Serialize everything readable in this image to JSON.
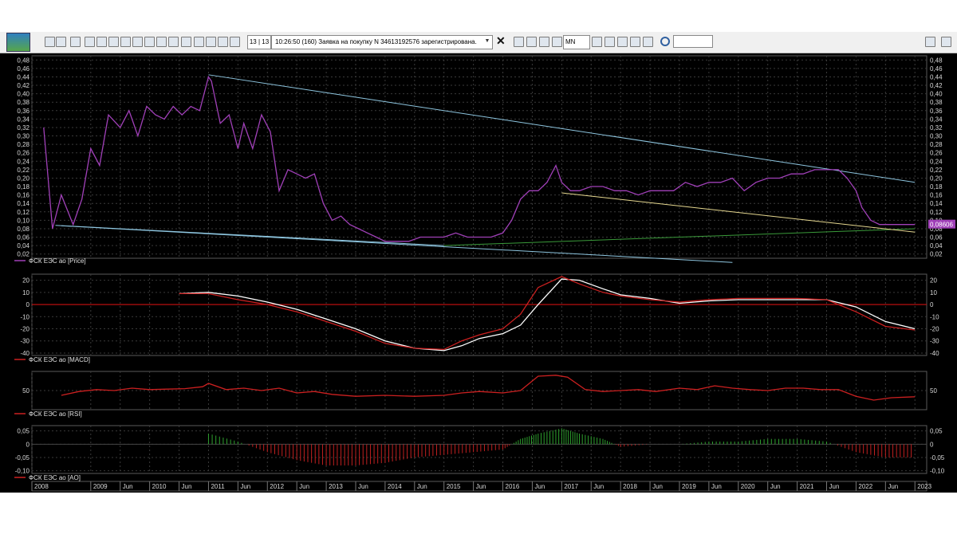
{
  "toolbar": {
    "counter": "13 | 13",
    "order_message": "10:26:50  (160)  Заявка на покупку N 34613192576 зарегистрирована.",
    "interval": "MN",
    "search_placeholder": ""
  },
  "chart_data": [
    {
      "type": "line",
      "legend": "ФСК ЕЭС ао [Price]",
      "ylim": [
        0.01,
        0.49
      ],
      "y_ticks": [
        "0,48",
        "0,46",
        "0,44",
        "0,42",
        "0,40",
        "0,38",
        "0,36",
        "0,34",
        "0,32",
        "0,30",
        "0,28",
        "0,26",
        "0,24",
        "0,22",
        "0,20",
        "0,18",
        "0,16",
        "0,14",
        "0,12",
        "0,10",
        "0,08",
        "0,06",
        "0,04",
        "0,02"
      ],
      "last_value_label": "0,08606",
      "colors": {
        "price": "#a040b8",
        "trend_upper": "#8ec6e0",
        "trend_lower": "#8ec6e0",
        "support": "#3a9a3a",
        "channel": "#e6d890"
      },
      "x": [
        2008.2,
        2008.35,
        2008.5,
        2008.7,
        2008.85,
        2009.0,
        2009.15,
        2009.3,
        2009.5,
        2009.65,
        2009.8,
        2009.95,
        2010.1,
        2010.25,
        2010.4,
        2010.55,
        2010.7,
        2010.85,
        2011.0,
        2011.05,
        2011.2,
        2011.35,
        2011.5,
        2011.6,
        2011.75,
        2011.9,
        2012.05,
        2012.2,
        2012.35,
        2012.5,
        2012.65,
        2012.8,
        2012.95,
        2013.1,
        2013.25,
        2013.4,
        2013.55,
        2013.7,
        2013.85,
        2014.0,
        2014.2,
        2014.4,
        2014.6,
        2014.8,
        2015.0,
        2015.2,
        2015.4,
        2015.6,
        2015.8,
        2016.0,
        2016.15,
        2016.3,
        2016.45,
        2016.6,
        2016.75,
        2016.9,
        2017.0,
        2017.15,
        2017.3,
        2017.5,
        2017.7,
        2017.9,
        2018.1,
        2018.3,
        2018.5,
        2018.7,
        2018.9,
        2019.1,
        2019.3,
        2019.5,
        2019.7,
        2019.9,
        2020.1,
        2020.3,
        2020.5,
        2020.7,
        2020.9,
        2021.1,
        2021.3,
        2021.5,
        2021.7,
        2021.85,
        2022.0,
        2022.1,
        2022.25,
        2022.4,
        2022.55,
        2022.7,
        2022.85,
        2023.0
      ],
      "y": [
        0.32,
        0.08,
        0.16,
        0.09,
        0.15,
        0.27,
        0.23,
        0.35,
        0.32,
        0.36,
        0.3,
        0.37,
        0.35,
        0.34,
        0.37,
        0.35,
        0.37,
        0.36,
        0.44,
        0.43,
        0.33,
        0.35,
        0.27,
        0.33,
        0.27,
        0.35,
        0.31,
        0.17,
        0.22,
        0.21,
        0.2,
        0.21,
        0.14,
        0.1,
        0.11,
        0.09,
        0.08,
        0.07,
        0.06,
        0.05,
        0.05,
        0.05,
        0.06,
        0.06,
        0.06,
        0.07,
        0.06,
        0.06,
        0.06,
        0.07,
        0.1,
        0.15,
        0.17,
        0.17,
        0.19,
        0.23,
        0.19,
        0.17,
        0.17,
        0.18,
        0.18,
        0.17,
        0.17,
        0.16,
        0.17,
        0.17,
        0.17,
        0.19,
        0.18,
        0.19,
        0.19,
        0.2,
        0.17,
        0.19,
        0.2,
        0.2,
        0.21,
        0.21,
        0.22,
        0.22,
        0.22,
        0.2,
        0.17,
        0.13,
        0.1,
        0.09,
        0.09,
        0.09,
        0.09,
        0.09
      ],
      "trendlines": [
        {
          "from": [
            2011.0,
            0.445
          ],
          "to": [
            2023.0,
            0.19
          ],
          "color": "#8ec6e0"
        },
        {
          "from": [
            2008.5,
            0.087
          ],
          "to": [
            2019.9,
            0.0
          ],
          "color": "#8ec6e0"
        },
        {
          "from": [
            2008.4,
            0.088
          ],
          "to": [
            2015.0,
            0.04
          ],
          "color": "#8ec6e0"
        },
        {
          "from": [
            2015.0,
            0.04
          ],
          "to": [
            2023.0,
            0.08
          ],
          "color": "#3a9a3a"
        },
        {
          "from": [
            2017.0,
            0.165
          ],
          "to": [
            2023.0,
            0.072
          ],
          "color": "#e6d890"
        }
      ]
    },
    {
      "type": "line",
      "legend": "ФСК ЕЭС ао [MACD]",
      "ylim": [
        -42,
        25
      ],
      "y_ticks": [
        "20",
        "10",
        "0",
        "-10",
        "-20",
        "-30",
        "-40"
      ],
      "zero_line_color": "#cc1111",
      "series": [
        {
          "color": "#ffffff",
          "x": [
            2010.5,
            2011.0,
            2011.5,
            2012.0,
            2012.5,
            2013.0,
            2013.5,
            2014.0,
            2014.5,
            2015.0,
            2015.3,
            2015.6,
            2016.0,
            2016.3,
            2016.6,
            2017.0,
            2017.3,
            2017.7,
            2018.0,
            2018.5,
            2019.0,
            2019.5,
            2020.0,
            2020.5,
            2021.0,
            2021.5,
            2022.0,
            2022.5,
            2023.0
          ],
          "y": [
            9,
            10,
            7,
            2,
            -4,
            -12,
            -20,
            -30,
            -36,
            -38,
            -34,
            -28,
            -24,
            -17,
            0,
            21,
            20,
            13,
            8,
            5,
            1,
            3,
            4,
            4,
            4,
            4,
            -2,
            -14,
            -20
          ]
        },
        {
          "color": "#cc2020",
          "x": [
            2010.5,
            2011.0,
            2011.5,
            2012.0,
            2012.5,
            2013.0,
            2013.5,
            2014.0,
            2014.5,
            2015.0,
            2015.3,
            2015.6,
            2016.0,
            2016.3,
            2016.6,
            2017.0,
            2017.3,
            2017.7,
            2018.0,
            2018.5,
            2019.0,
            2019.5,
            2020.0,
            2020.5,
            2021.0,
            2021.5,
            2022.0,
            2022.5,
            2023.0
          ],
          "y": [
            9,
            9,
            4,
            0,
            -6,
            -14,
            -22,
            -32,
            -36,
            -37,
            -30,
            -25,
            -20,
            -8,
            14,
            23,
            17,
            10,
            7,
            4,
            2,
            4,
            5,
            5,
            5,
            4,
            -6,
            -18,
            -21
          ]
        }
      ]
    },
    {
      "type": "line",
      "legend": "ФСК ЕЭС ао [RSI]",
      "ylim": [
        10,
        90
      ],
      "y_ticks": [
        "50"
      ],
      "series": [
        {
          "color": "#cc2020",
          "x": [
            2008.5,
            2008.8,
            2009.1,
            2009.4,
            2009.7,
            2010.0,
            2010.3,
            2010.6,
            2010.9,
            2011.0,
            2011.3,
            2011.6,
            2011.9,
            2012.2,
            2012.5,
            2012.8,
            2013.1,
            2013.5,
            2014.0,
            2014.5,
            2015.0,
            2015.3,
            2015.6,
            2016.0,
            2016.3,
            2016.6,
            2016.9,
            2017.1,
            2017.4,
            2017.7,
            2018.0,
            2018.3,
            2018.6,
            2019.0,
            2019.3,
            2019.6,
            2019.9,
            2020.2,
            2020.5,
            2020.8,
            2021.1,
            2021.4,
            2021.7,
            2022.0,
            2022.3,
            2022.6,
            2023.0
          ],
          "y": [
            40,
            48,
            52,
            50,
            55,
            52,
            53,
            54,
            58,
            65,
            52,
            55,
            50,
            55,
            45,
            48,
            42,
            38,
            40,
            38,
            40,
            45,
            48,
            45,
            50,
            80,
            82,
            78,
            52,
            48,
            50,
            52,
            48,
            55,
            52,
            60,
            55,
            52,
            50,
            55,
            55,
            52,
            52,
            38,
            30,
            35,
            37
          ]
        }
      ]
    },
    {
      "type": "bar",
      "legend": "ФСК ЕЭС ао [AO]",
      "ylim": [
        -0.11,
        0.07
      ],
      "y_ticks": [
        "0,05",
        "0",
        "-0,05",
        "-0,10"
      ],
      "colors": {
        "up": "#2ea02e",
        "down": "#c02020"
      },
      "x": [
        2011.0,
        2011.5,
        2012.0,
        2012.5,
        2013.0,
        2013.5,
        2014.0,
        2014.5,
        2015.0,
        2015.5,
        2016.0,
        2016.3,
        2016.6,
        2017.0,
        2017.3,
        2017.7,
        2018.0,
        2018.5,
        2019.0,
        2019.5,
        2020.0,
        2020.5,
        2021.0,
        2021.5,
        2022.0,
        2022.5,
        2023.0
      ],
      "values": [
        0.04,
        0.01,
        -0.03,
        -0.06,
        -0.08,
        -0.08,
        -0.07,
        -0.05,
        -0.04,
        -0.03,
        -0.02,
        0.02,
        0.04,
        0.06,
        0.04,
        0.02,
        -0.01,
        0.0,
        0.0,
        0.01,
        0.01,
        0.02,
        0.02,
        0.01,
        -0.03,
        -0.05,
        -0.05
      ]
    }
  ],
  "time_axis": {
    "labels": [
      "2008",
      "2009",
      "Jun",
      "2010",
      "Jun",
      "2011",
      "Jun",
      "2012",
      "Jun",
      "2013",
      "Jun",
      "2014",
      "Jun",
      "2015",
      "Jun",
      "2016",
      "Jun",
      "2017",
      "Jun",
      "2018",
      "Jun",
      "2019",
      "Jun",
      "2020",
      "Jun",
      "2021",
      "Jun",
      "2022",
      "Jun",
      "2023"
    ],
    "values": [
      2008,
      2009,
      2009.5,
      2010,
      2010.5,
      2011,
      2011.5,
      2012,
      2012.5,
      2013,
      2013.5,
      2014,
      2014.5,
      2015,
      2015.5,
      2016,
      2016.5,
      2017,
      2017.5,
      2018,
      2018.5,
      2019,
      2019.5,
      2020,
      2020.5,
      2021,
      2021.5,
      2022,
      2022.5,
      2023
    ]
  }
}
